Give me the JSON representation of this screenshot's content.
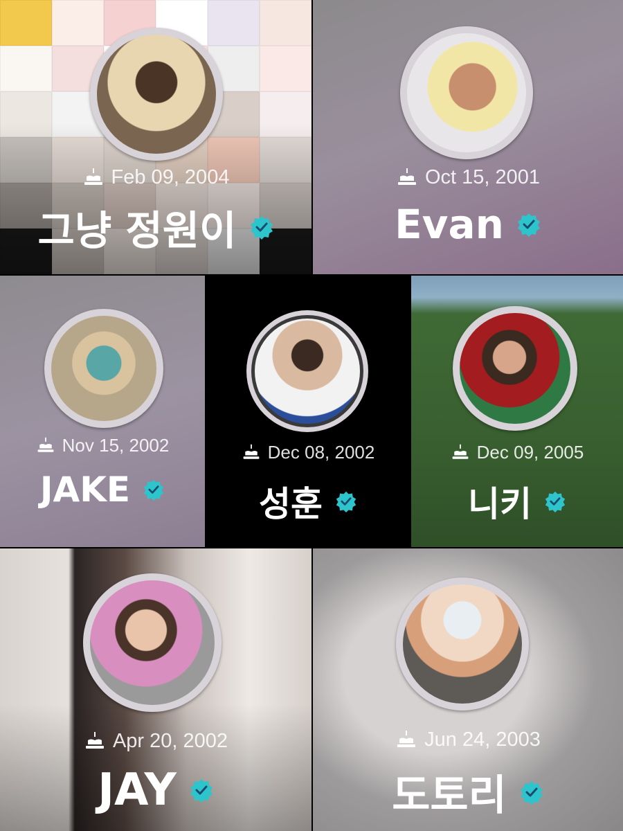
{
  "profiles": [
    {
      "date": "Feb 09, 2004",
      "name": "그냥 정원이",
      "cake_icon": "cake-icon",
      "badge_icon": "verified-badge-icon",
      "badge_color": "#2ec4cc"
    },
    {
      "date": "Oct 15, 2001",
      "name": "Evan",
      "cake_icon": "cake-icon",
      "badge_icon": "verified-badge-icon",
      "badge_color": "#2ec4cc"
    },
    {
      "date": "Nov 15, 2002",
      "name": "JAKE",
      "cake_icon": "cake-icon",
      "badge_icon": "verified-badge-icon",
      "badge_color": "#2ec4cc"
    },
    {
      "date": "Dec 08, 2002",
      "name": "성훈",
      "cake_icon": "cake-icon",
      "badge_icon": "verified-badge-icon",
      "badge_color": "#2ec4cc"
    },
    {
      "date": "Dec 09, 2005",
      "name": "니키",
      "cake_icon": "cake-icon",
      "badge_icon": "verified-badge-icon",
      "badge_color": "#2ec4cc"
    },
    {
      "date": "Apr 20, 2002",
      "name": "JAY",
      "cake_icon": "cake-icon",
      "badge_icon": "verified-badge-icon",
      "badge_color": "#2ec4cc"
    },
    {
      "date": "Jun 24, 2003",
      "name": "도토리",
      "cake_icon": "cake-icon",
      "badge_icon": "verified-badge-icon",
      "badge_color": "#2ec4cc"
    }
  ]
}
